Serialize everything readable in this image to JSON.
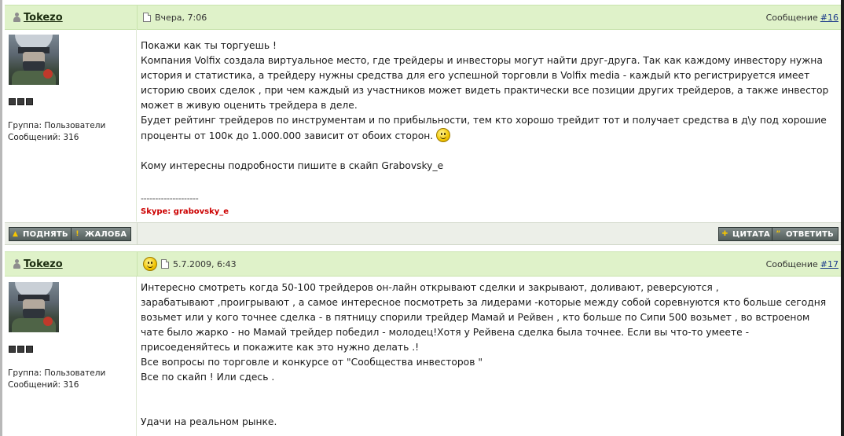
{
  "posts": [
    {
      "author": "Tokezo",
      "date": "Вчера, 7:06",
      "msg_label": "Сообщение",
      "msg_num": "#16",
      "group": "Группа: Пользователи",
      "count": "Сообщений: 316",
      "text": "Покажи как ты торгуешь !\nКомпания Volfix создала виртуальное место, где трейдеры и инвесторы могут найти друг-друга. Так как каждому инвестору нужна история и статистика, а трейдеру нужны средства для его успешной торговли в Volfix media - каждый кто регистрируется имеет историю своих сделок , при чем каждый из участников может видеть практически все позиции других трейдеров, а также инвестор может в живую оценить трейдера в деле.\nБудет рейтинг трейдеров по инструментам и по прибыльности, тем кто хорошо трейдит тот и получает средства в д\\у под хорошие проценты от 100к до 1.000.000 зависит от обоих сторон.",
      "text2": "Кому интересны подробности пишите в скайп Grabovsky_e",
      "sig_line": "--------------------",
      "sig": "Skype: grabovsky_e",
      "buttons": {
        "up": "ПОДНЯТЬ",
        "report": "ЖАЛОБА",
        "quote": "ЦИТАТА",
        "reply": "ОТВЕТИТЬ"
      }
    },
    {
      "author": "Tokezo",
      "date": "5.7.2009, 6:43",
      "msg_label": "Сообщение",
      "msg_num": "#17",
      "group": "Группа: Пользователи",
      "count": "Сообщений: 316",
      "text": "Интересно смотреть когда 50-100 трейдеров он-лайн открывают сделки и закрывают, доливают, реверсуются ,\nзарабатывают ,проигрывают , а самое интересное посмотреть за лидерами -которые между собой соревнуются кто больше сегодня возьмет или у кого точнее сделка - в пятницу спорили трейдер Мамай и Рейвен , кто больше по Сипи 500 возьмет , во встроеном чате было жарко - но Мамай трейдер победил - молодец!Хотя у Рейвена сделка была точнее. Если вы что-то умеете - присоеденяйтесь и покажите как это нужно делать .!\nВсе вопросы по торговле и конкурсе от \"Сообщества инвесторов \"\nВсе по скайп ! Или сдесь .\n\n\nУдачи на реальном рынке."
    }
  ]
}
